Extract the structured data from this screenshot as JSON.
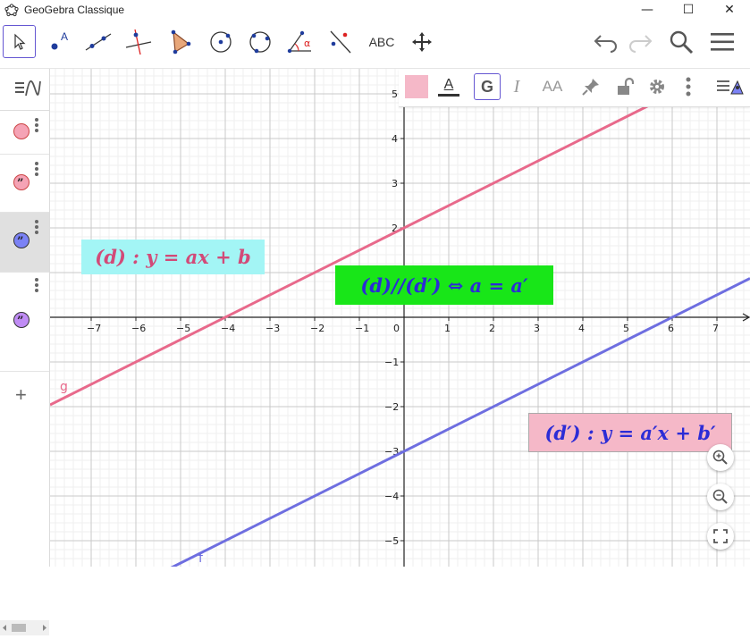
{
  "window": {
    "title": "GeoGebra Classique",
    "minimize": "—",
    "maximize": "☐",
    "close": "✕"
  },
  "toolbar": {
    "tools": [
      {
        "name": "move-tool",
        "active": true
      },
      {
        "name": "point-tool",
        "label": "A"
      },
      {
        "name": "line-tool"
      },
      {
        "name": "perpendicular-tool"
      },
      {
        "name": "polygon-tool"
      },
      {
        "name": "circle-center-tool"
      },
      {
        "name": "circle-three-points-tool"
      },
      {
        "name": "angle-tool",
        "label": "α"
      },
      {
        "name": "reflect-tool"
      },
      {
        "name": "text-tool",
        "label": "ABC"
      },
      {
        "name": "move-view-tool"
      }
    ],
    "right": [
      "undo-icon",
      "redo-icon",
      "search-icon",
      "menu-icon"
    ]
  },
  "style_bar": {
    "text_color_label": "A",
    "bold_label": "G",
    "italic_label": "I",
    "size_label": "AA"
  },
  "sidebar": {
    "items": [
      {
        "icon": "pink-circle-icon",
        "color": "#f5a3b5"
      },
      {
        "icon": "quote-pink-icon",
        "color": "#f5a3b5"
      },
      {
        "icon": "quote-blue-icon",
        "color": "#7b82f5"
      },
      {
        "icon": "quote-purple-icon",
        "color": "#c08cf5"
      }
    ],
    "add_label": "+"
  },
  "graph": {
    "x_ticks": [
      "−7",
      "−6",
      "−5",
      "−4",
      "−3",
      "−2",
      "−1",
      "0",
      "1",
      "2",
      "3",
      "4",
      "5",
      "6",
      "7"
    ],
    "y_ticks_pos": [
      "5",
      "4",
      "3",
      "2",
      "1"
    ],
    "y_ticks_neg": [
      "−1",
      "−2",
      "−3",
      "−4",
      "−5"
    ],
    "lines": [
      {
        "name": "g",
        "slope": 0.5,
        "intercept": 2,
        "color": "#e8698b"
      },
      {
        "name": "f",
        "slope": 0.5,
        "intercept": -3,
        "color": "#6e6ee0"
      }
    ],
    "texts": [
      {
        "label": "(d) : y = ax + b",
        "bg": "#a3f5f5",
        "color": "#d24a78"
      },
      {
        "label": "(d)//(d′) ⇔ a = a′",
        "bg": "#18e618",
        "color": "#2c2cd6"
      },
      {
        "label": "(d′) : y = a′x + b′",
        "bg": "#f5b8c8",
        "color": "#2c2cd6"
      }
    ]
  },
  "zoom": {
    "zoom_in": "zoom-in-icon",
    "zoom_out": "zoom-out-icon",
    "fullscreen": "fullscreen-icon"
  }
}
